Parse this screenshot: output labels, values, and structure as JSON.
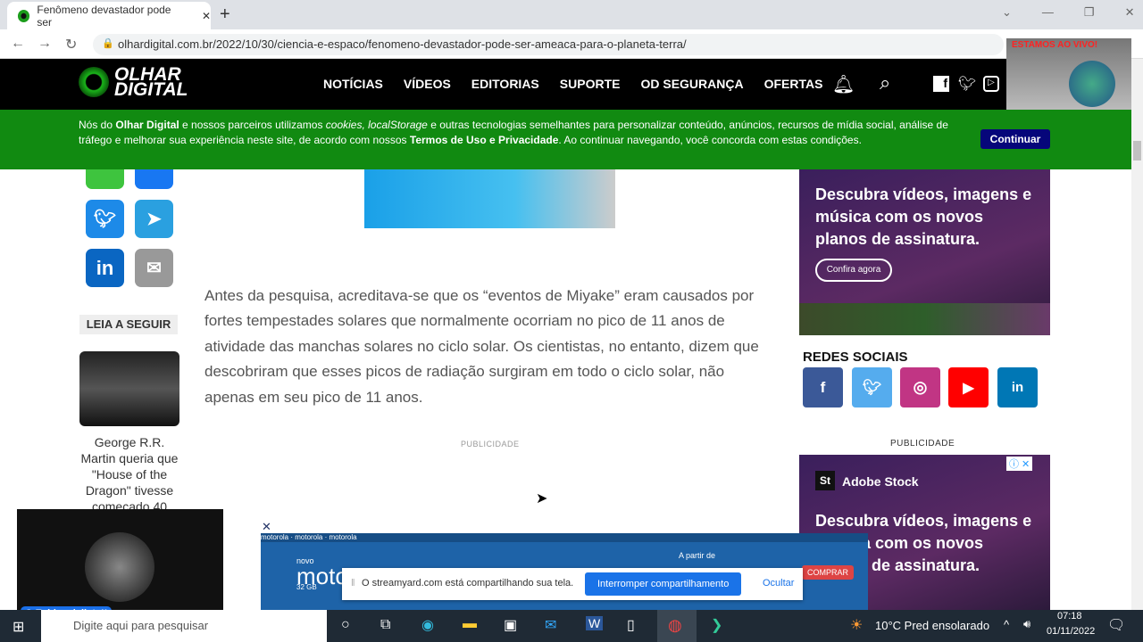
{
  "browser": {
    "tab_title": "Fenômeno devastador pode ser",
    "url": "olhardigital.com.br/2022/10/30/ciencia-e-espaco/fenomeno-devastador-pode-ser-ameaca-para-o-planeta-terra/"
  },
  "site": {
    "logo_line1": "OLHAR",
    "logo_line2": "DIGITAL",
    "menu": [
      "NOTÍCIAS",
      "VÍDEOS",
      "EDITORIAS",
      "SUPORTE",
      "OD SEGURANÇA",
      "OFERTAS"
    ]
  },
  "live_badge": "ESTAMOS AO VIVO!",
  "cookie": {
    "p1": "Nós do ",
    "brand": "Olhar Digital",
    "p2": " e nossos parceiros utilizamos ",
    "i1": "cookies, localStorage",
    "p3": " e outras tecnologias semelhantes para personalizar conteúdo, anúncios, recursos de mídia social, análise de tráfego e melhorar sua experiência neste site, de acordo com nossos ",
    "terms": "Termos de Uso e Privacidade",
    "p4": ". Ao continuar navegando, você concorda com estas condições.",
    "button": "Continuar"
  },
  "leia": {
    "heading": "LEIA A SEGUIR",
    "item": "George R.R. Martin queria que \"House of the Dragon\" tivesse começado 40"
  },
  "article": {
    "paragraph": "Antes da pesquisa, acreditava-se que os “eventos de Miyake” eram causados por fortes tempestades solares que normalmente ocorriam no pico de 11 anos de atividade das manchas solares no ciclo solar. Os cientistas, no entanto, dizem que descobriram que esses picos de radiação surgiram em todo o ciclo solar, não apenas em seu pico de 11 anos."
  },
  "publicidade": "PUBLICIDADE",
  "ad1": {
    "headline": "Descubra vídeos, imagens e música com os novos planos de assinatura.",
    "button": "Confira agora"
  },
  "redes": {
    "heading": "REDES SOCIAIS"
  },
  "ad2": {
    "brand": "Adobe Stock",
    "logo": "St",
    "headline": "Descubra vídeos, imagens e música com os novos planos de assinatura."
  },
  "moto": {
    "brand": "motorola",
    "novo": "novo",
    "model": "moto",
    "storage": "32 GB",
    "partir": "A partir de",
    "comprar": "COMPRAR"
  },
  "share": {
    "text": "O streamyard.com está compartilhando sua tela.",
    "stop": "Interromper compartilhamento",
    "hide": "Ocultar"
  },
  "webcam": {
    "label": "O Evidencialista!!"
  },
  "taskbar": {
    "search": "Digite aqui para pesquisar",
    "weather": "10°C  Pred ensolarado",
    "time": "07:18",
    "date": "01/11/2022"
  }
}
